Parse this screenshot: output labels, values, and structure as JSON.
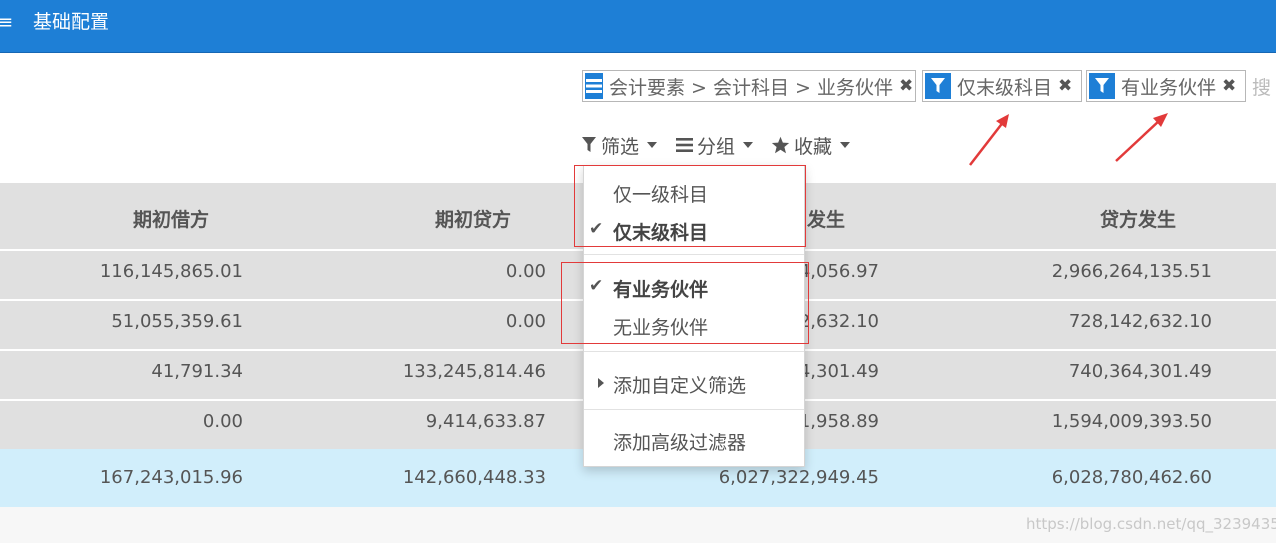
{
  "app": {
    "title": "基础配置",
    "menu_glyph": "≡"
  },
  "facets": [
    {
      "icon": "list-icon",
      "label": "会计要素 > 会计科目 > 业务伙伴",
      "close": "✖"
    },
    {
      "icon": "filter-icon",
      "label": "仅末级科目",
      "close": "✖"
    },
    {
      "icon": "filter-icon",
      "label": "有业务伙伴",
      "close": "✖"
    }
  ],
  "search": {
    "placeholder": "搜"
  },
  "toolbar": {
    "filter_label": "筛选",
    "group_label": "分组",
    "favorite_label": "收藏"
  },
  "table": {
    "headers": [
      "期初借方",
      "期初贷方",
      "借方发生",
      "贷方发生"
    ],
    "rows": [
      [
        "116,145,865.01",
        "0.00",
        "2,966,264,056.97",
        "2,966,264,135.51"
      ],
      [
        "51,055,359.61",
        "0.00",
        "728,142,632.10",
        "728,142,632.10"
      ],
      [
        "41,791.34",
        "133,245,814.46",
        "740,364,301.49",
        "740,364,301.49"
      ],
      [
        "0.00",
        "9,414,633.87",
        "1,594,191,958.89",
        "1,594,009,393.50"
      ]
    ],
    "visible_rows": [
      [
        "116,145,865.01",
        "0.00",
        "4,056.97",
        "2,966,264,135.51"
      ],
      [
        "51,055,359.61",
        "0.00",
        "2,632.10",
        "728,142,632.10"
      ],
      [
        "41,791.34",
        "133,245,814.46",
        "4,301.49",
        "740,364,301.49"
      ],
      [
        "0.00",
        "9,414,633.87",
        "1,958.89",
        "1,594,009,393.50"
      ]
    ],
    "visible_header_3": "发生",
    "totals": [
      "167,243,015.96",
      "142,660,448.33",
      "6,027,322,949.45",
      "6,028,780,462.60"
    ]
  },
  "dropdown": {
    "items": [
      {
        "label": "仅一级科目",
        "checked": false
      },
      {
        "label": "仅末级科目",
        "checked": true
      },
      {
        "label": "有业务伙伴",
        "checked": true
      },
      {
        "label": "无业务伙伴",
        "checked": false
      },
      {
        "label": "添加自定义筛选",
        "expandable": true
      },
      {
        "label": "添加高级过滤器"
      }
    ]
  },
  "watermark": "https://blog.csdn.net/qq_32394351",
  "colors": {
    "header_blue": "#1e7fd6",
    "row_gray": "#e0e0e0",
    "total_blue": "#d1eefb",
    "annotation_red": "#e23a3a"
  }
}
